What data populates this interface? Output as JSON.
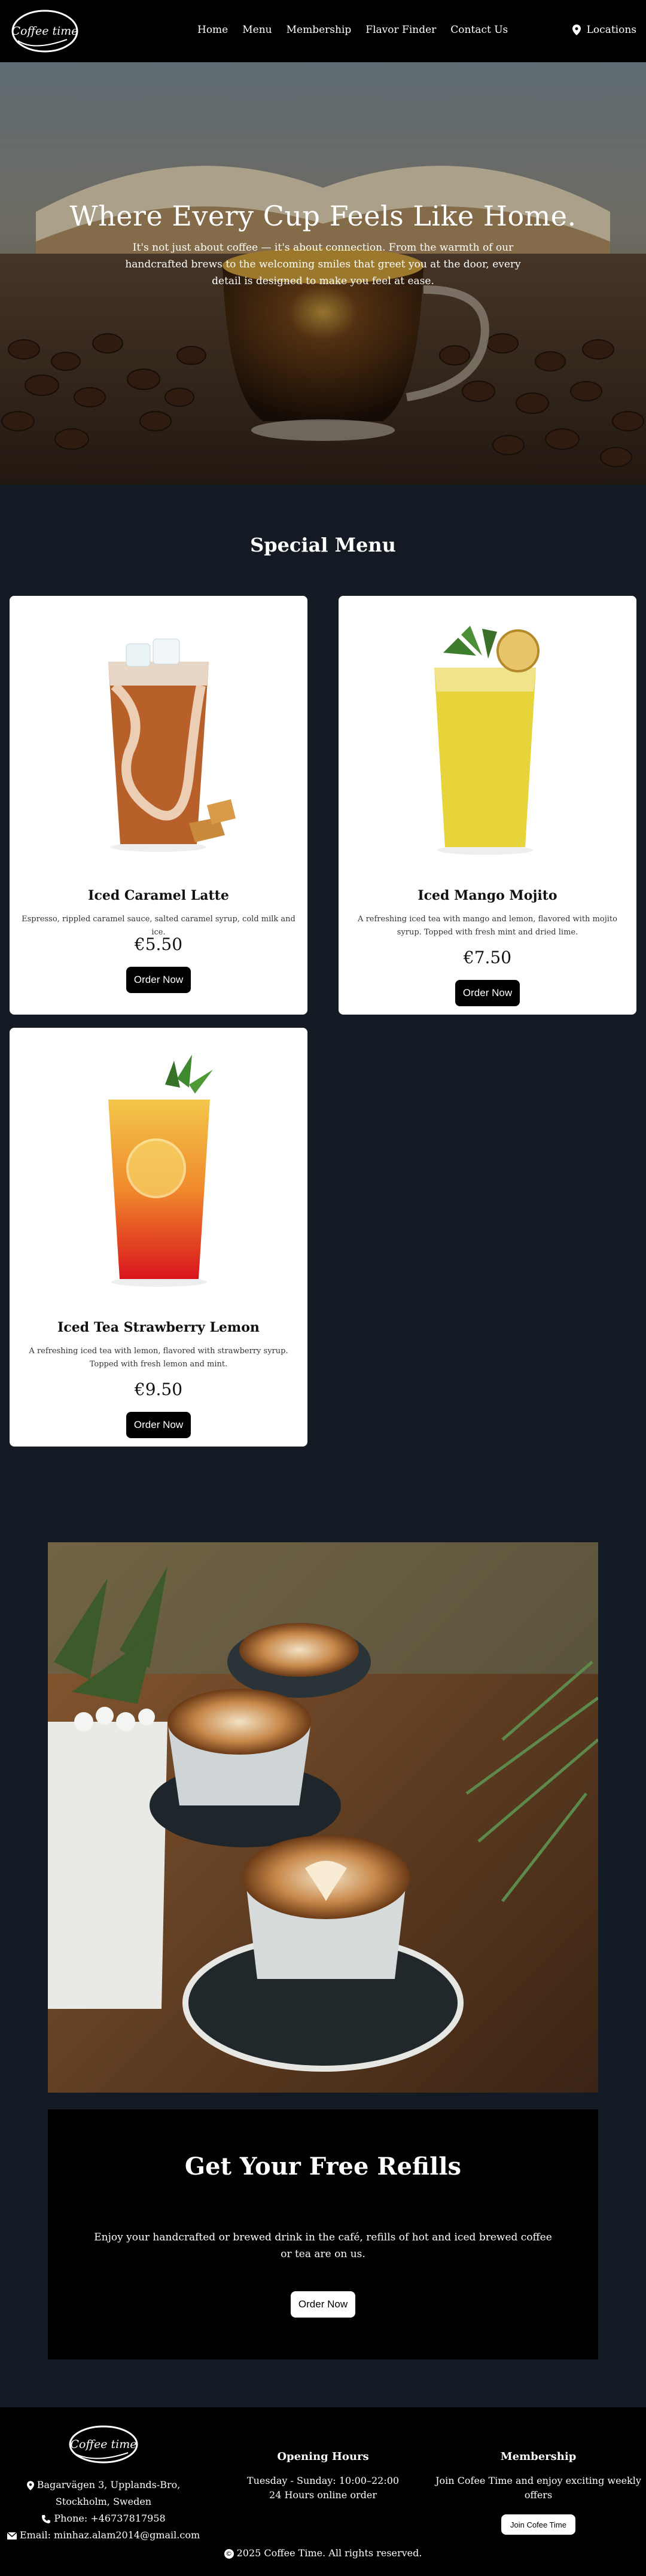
{
  "nav": {
    "logo_text": "Coffee time",
    "links": [
      "Home",
      "Menu",
      "Membership",
      "Flavor Finder",
      "Contact Us"
    ],
    "locations_label": "Locations"
  },
  "hero": {
    "title": "Where Every Cup Feels Like Home.",
    "subtitle": "It's not just about coffee — it's about connection. From the warmth of our handcrafted brews to the welcoming smiles that greet you at the door, every detail is designed to make you feel at ease."
  },
  "special": {
    "title": "Special Menu",
    "items": [
      {
        "name": "Iced Caramel Latte",
        "desc": "Espresso, rippled caramel sauce, salted caramel syrup, cold milk and ice.",
        "price": "€5.50",
        "button": "Order Now"
      },
      {
        "name": "Iced Mango Mojito",
        "desc": "A refreshing iced tea with mango and lemon, flavored with mojito syrup. Topped with fresh mint and dried lime.",
        "price": "€7.50",
        "button": "Order Now"
      },
      {
        "name": "Iced Tea Strawberry Lemon",
        "desc": "A refreshing iced tea with lemon, flavored with strawberry syrup. Topped with fresh lemon and mint.",
        "price": "€9.50",
        "button": "Order Now"
      }
    ]
  },
  "refill": {
    "title": "Get Your Free Refills",
    "text": "Enjoy your handcrafted or brewed drink in the café, refills of hot and iced brewed coffee or tea are on us.",
    "button": "Order Now"
  },
  "footer": {
    "logo_text": "Coffee time",
    "address": "Bagarvägen 3, Upplands-Bro, Stockholm, Sweden",
    "phone": "Phone: +46737817958",
    "email": "Email: minhaz.alam2014@gmail.com",
    "hours_title": "Opening Hours",
    "hours_line1": "Tuesday - Sunday: 10:00–22:00",
    "hours_line2": "24 Hours online order",
    "membership_title": "Membership",
    "membership_text": "Join Cofee Time and enjoy exciting weekly offers",
    "membership_button": "Join Cofee Time",
    "copyright": "2025 Coffee Time. All rights reserved."
  },
  "colors": {
    "page_bg": "#141a23",
    "nav_bg": "#000000",
    "card_bg": "#ffffff"
  }
}
